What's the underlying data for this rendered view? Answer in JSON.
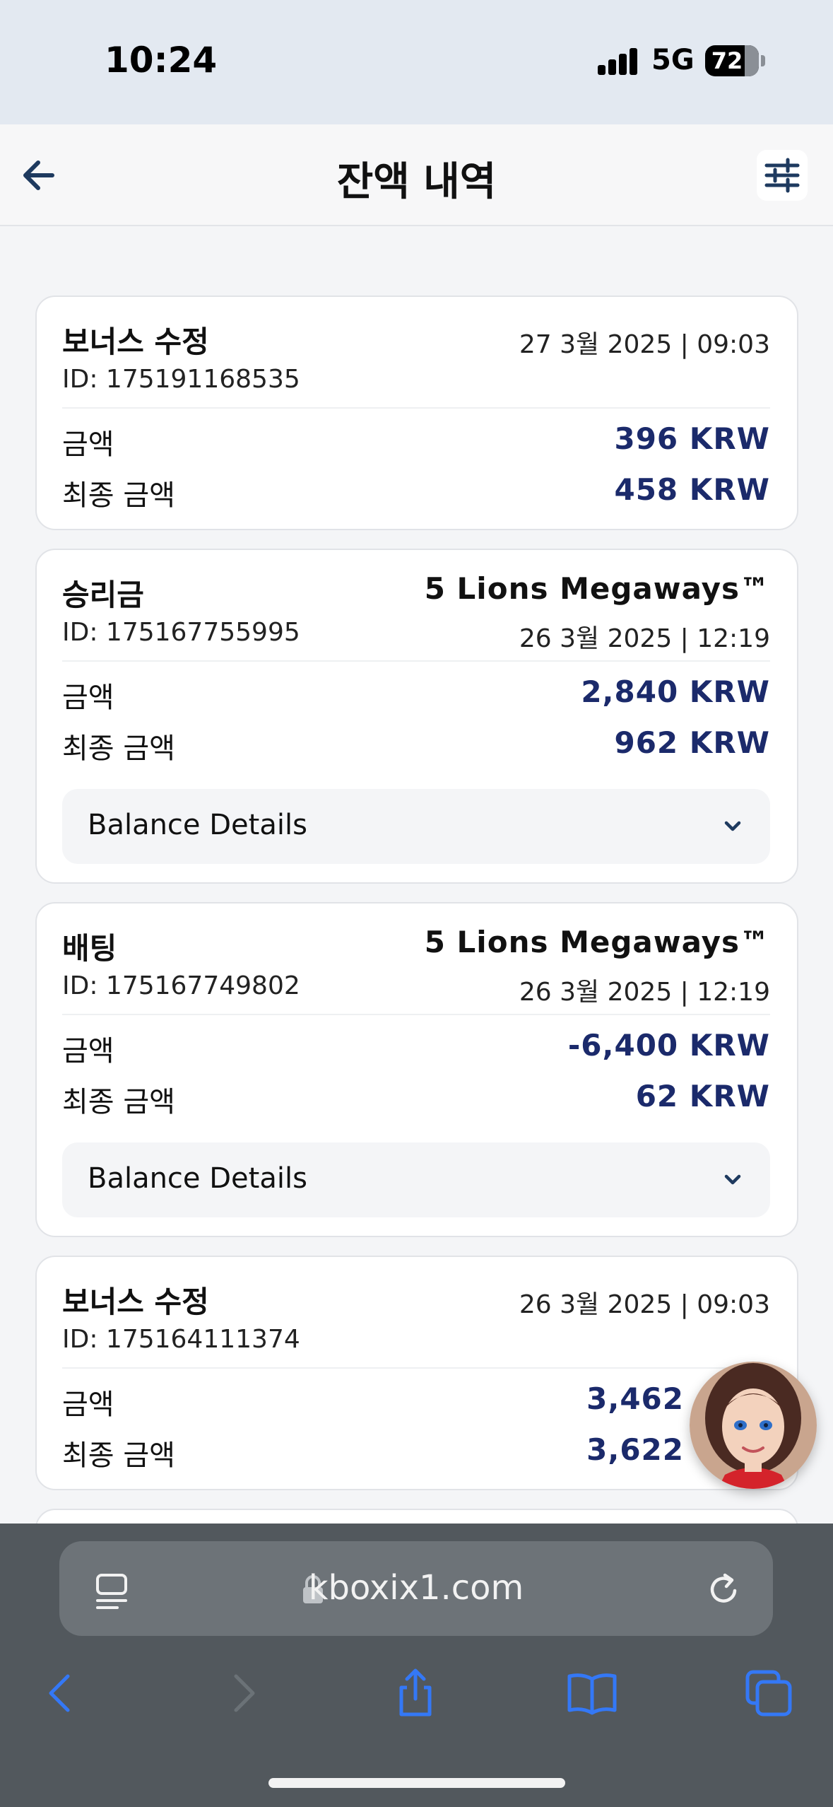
{
  "status_bar": {
    "time": "10:24",
    "network": "5G",
    "battery": "72"
  },
  "header": {
    "title": "잔액 내역"
  },
  "transactions": [
    {
      "title": "보너스 수정",
      "game": "",
      "date": "27 3월 2025 | 09:03",
      "id": "ID: 175191168535",
      "amount_label": "금액",
      "amount": "396 KRW",
      "final_label": "최종 금액",
      "final_amount": "458 KRW",
      "details_label": ""
    },
    {
      "title": "승리금",
      "game": "5 Lions Megaways™",
      "date": "26 3월 2025 | 12:19",
      "id": "ID: 175167755995",
      "amount_label": "금액",
      "amount": "2,840 KRW",
      "final_label": "최종 금액",
      "final_amount": "962 KRW",
      "details_label": "Balance Details"
    },
    {
      "title": "배팅",
      "game": "5 Lions Megaways™",
      "date": "26 3월 2025 | 12:19",
      "id": "ID: 175167749802",
      "amount_label": "금액",
      "amount": "-6,400 KRW",
      "final_label": "최종 금액",
      "final_amount": "62 KRW",
      "details_label": "Balance Details"
    },
    {
      "title": "보너스 수정",
      "game": "",
      "date": "26 3월 2025 | 09:03",
      "id": "ID: 175164111374",
      "amount_label": "금액",
      "amount": "3,462",
      "final_label": "최종 금액",
      "final_amount": "3,622",
      "details_label": ""
    }
  ],
  "browser": {
    "url": "kboxix1.com"
  },
  "icons": {
    "back": "arrow-left-icon",
    "filter": "sliders-icon",
    "chevron": "chevron-down-icon",
    "lock": "lock-icon",
    "reload": "reload-icon",
    "page": "page-menu-icon",
    "nav_back": "chevron-left-icon",
    "nav_forward": "chevron-right-icon",
    "share": "share-icon",
    "bookmarks": "book-icon",
    "tabs": "tabs-icon"
  },
  "colors": {
    "amount": "#1b2a6b",
    "header_icon": "#1e3a5f",
    "safari_blue": "#3478f6"
  }
}
